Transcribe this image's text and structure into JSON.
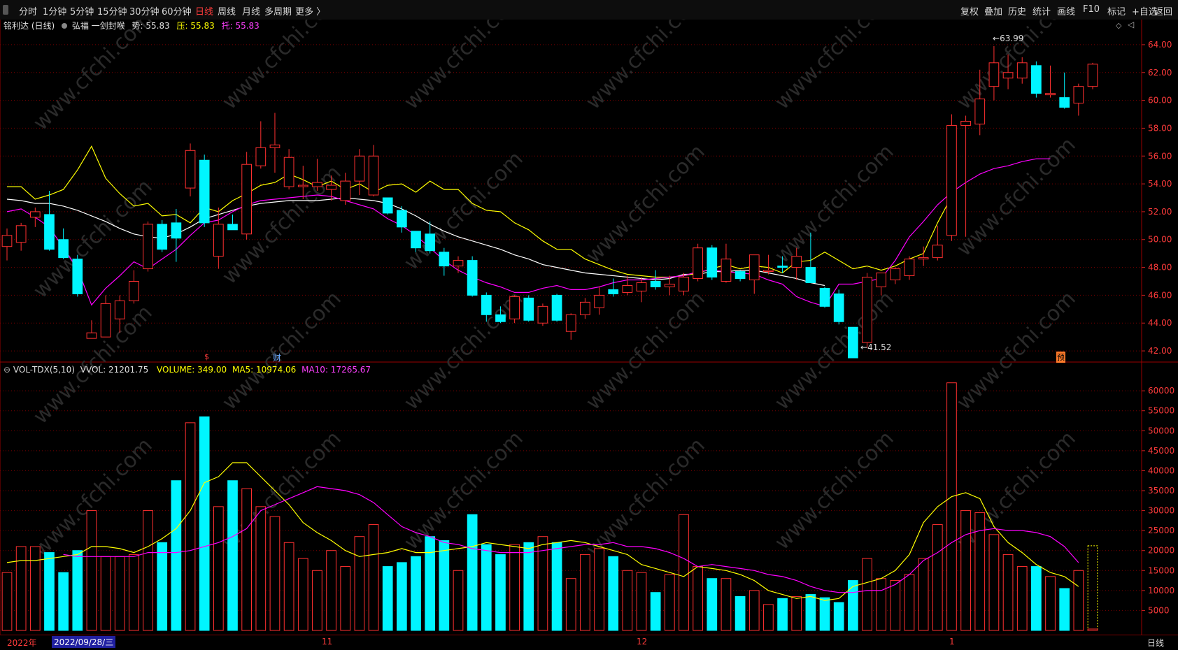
{
  "toolbar": {
    "periods": [
      "分时",
      "1分钟",
      "5分钟",
      "15分钟",
      "30分钟",
      "60分钟",
      "日线",
      "周线",
      "月线",
      "多周期",
      "更多 〉"
    ],
    "active_index": 6,
    "right_buttons": [
      "复权",
      "叠加",
      "历史",
      "统计",
      "画线",
      "F10",
      "标记",
      "+自选",
      "返回"
    ]
  },
  "header": {
    "stock": "铭利达 (日线)",
    "indicator": "弘福 一剑封喉",
    "shi_label": "势: 55.83",
    "ya_label": "压: 55.83",
    "tuo_label": "托: 55.83"
  },
  "price_axis": [
    "64.00",
    "62.00",
    "60.00",
    "58.00",
    "56.00",
    "54.00",
    "52.00",
    "50.00",
    "48.00",
    "46.00",
    "44.00",
    "42.00"
  ],
  "volume_axis": [
    "60000",
    "55000",
    "50000",
    "45000",
    "40000",
    "35000",
    "30000",
    "25000",
    "20000",
    "15000",
    "10000",
    "5000"
  ],
  "volume_header": {
    "name": "VOL-TDX(5,10)",
    "vvol": "VVOL: 21201.75",
    "volume": "VOLUME: 349.00",
    "ma5": "MA5: 10974.06",
    "ma10": "MA10: 17265.67"
  },
  "annotations": {
    "high": "63.99",
    "low": "41.52",
    "marker_s": "$",
    "marker_cai": "财",
    "marker_yu": "预"
  },
  "bottom": {
    "year": "2022年",
    "date_box": "2022/09/28/三",
    "m11": "11",
    "m12": "12",
    "m1": "1",
    "period_tag": "日线"
  },
  "colors": {
    "up": "#ff3030",
    "down": "#00f5ff",
    "ma_yellow": "#ffff00",
    "ma_white": "#ffffff",
    "ma_magenta": "#ff00ff",
    "grid": "#7a0000"
  },
  "chart_data": {
    "type": "candlestick",
    "price_range": [
      41.2,
      64.8
    ],
    "volume_range": [
      0,
      63000
    ],
    "candles": [
      {
        "o": 49.5,
        "h": 50.8,
        "l": 48.5,
        "c": 50.3,
        "v": 14500
      },
      {
        "o": 49.8,
        "h": 51.2,
        "l": 49.2,
        "c": 51.0,
        "v": 21000
      },
      {
        "o": 51.6,
        "h": 52.3,
        "l": 50.9,
        "c": 52.0,
        "v": 21000
      },
      {
        "o": 51.8,
        "h": 53.5,
        "l": 49.2,
        "c": 49.3,
        "v": 19500
      },
      {
        "o": 50.0,
        "h": 50.8,
        "l": 48.6,
        "c": 48.7,
        "v": 14500
      },
      {
        "o": 48.6,
        "h": 48.9,
        "l": 45.9,
        "c": 46.1,
        "v": 20000
      },
      {
        "o": 42.9,
        "h": 44.2,
        "l": 42.9,
        "c": 43.3,
        "v": 30000
      },
      {
        "o": 43.0,
        "h": 46.0,
        "l": 43.0,
        "c": 45.4,
        "v": 18500
      },
      {
        "o": 44.3,
        "h": 46.0,
        "l": 43.3,
        "c": 45.6,
        "v": 18500
      },
      {
        "o": 45.6,
        "h": 47.8,
        "l": 45.4,
        "c": 47.0,
        "v": 19000
      },
      {
        "o": 47.9,
        "h": 51.3,
        "l": 47.7,
        "c": 51.1,
        "v": 30000
      },
      {
        "o": 51.1,
        "h": 51.4,
        "l": 49.1,
        "c": 49.3,
        "v": 22000
      },
      {
        "o": 51.2,
        "h": 52.2,
        "l": 48.4,
        "c": 50.1,
        "v": 37500
      },
      {
        "o": 53.7,
        "h": 56.9,
        "l": 53.1,
        "c": 56.4,
        "v": 52000
      },
      {
        "o": 55.7,
        "h": 56.1,
        "l": 50.9,
        "c": 51.2,
        "v": 53500
      },
      {
        "o": 48.8,
        "h": 52.3,
        "l": 47.9,
        "c": 51.1,
        "v": 31000
      },
      {
        "o": 51.1,
        "h": 51.8,
        "l": 50.7,
        "c": 50.7,
        "v": 37500
      },
      {
        "o": 50.4,
        "h": 56.3,
        "l": 50.0,
        "c": 55.4,
        "v": 35500
      },
      {
        "o": 55.3,
        "h": 58.5,
        "l": 55.1,
        "c": 56.6,
        "v": 31000
      },
      {
        "o": 56.6,
        "h": 59.1,
        "l": 54.8,
        "c": 56.8,
        "v": 28500
      },
      {
        "o": 53.8,
        "h": 56.5,
        "l": 53.6,
        "c": 55.9,
        "v": 22000
      },
      {
        "o": 53.8,
        "h": 55.3,
        "l": 52.9,
        "c": 53.9,
        "v": 18000
      },
      {
        "o": 53.8,
        "h": 55.8,
        "l": 53.5,
        "c": 54.1,
        "v": 15000
      },
      {
        "o": 53.6,
        "h": 54.6,
        "l": 52.8,
        "c": 53.9,
        "v": 20000
      },
      {
        "o": 52.8,
        "h": 54.8,
        "l": 52.5,
        "c": 54.2,
        "v": 16000
      },
      {
        "o": 54.2,
        "h": 56.5,
        "l": 53.2,
        "c": 56.0,
        "v": 23500
      },
      {
        "o": 53.2,
        "h": 56.8,
        "l": 53.1,
        "c": 56.0,
        "v": 26500
      },
      {
        "o": 53.0,
        "h": 53.0,
        "l": 51.8,
        "c": 51.9,
        "v": 16000
      },
      {
        "o": 52.1,
        "h": 52.4,
        "l": 50.5,
        "c": 50.9,
        "v": 17000
      },
      {
        "o": 50.6,
        "h": 50.6,
        "l": 49.1,
        "c": 49.4,
        "v": 18500
      },
      {
        "o": 50.4,
        "h": 51.3,
        "l": 49.0,
        "c": 49.2,
        "v": 23500
      },
      {
        "o": 49.1,
        "h": 49.4,
        "l": 47.4,
        "c": 48.1,
        "v": 22500
      },
      {
        "o": 48.1,
        "h": 48.8,
        "l": 47.6,
        "c": 48.5,
        "v": 15000
      },
      {
        "o": 48.5,
        "h": 48.8,
        "l": 45.9,
        "c": 46.0,
        "v": 29000
      },
      {
        "o": 46.0,
        "h": 46.2,
        "l": 44.1,
        "c": 44.6,
        "v": 21500
      },
      {
        "o": 44.6,
        "h": 45.2,
        "l": 44.0,
        "c": 44.1,
        "v": 19000
      },
      {
        "o": 44.3,
        "h": 46.0,
        "l": 44.0,
        "c": 45.9,
        "v": 21500
      },
      {
        "o": 45.8,
        "h": 46.0,
        "l": 44.1,
        "c": 44.2,
        "v": 22000
      },
      {
        "o": 44.0,
        "h": 45.4,
        "l": 43.8,
        "c": 45.2,
        "v": 23500
      },
      {
        "o": 46.0,
        "h": 46.1,
        "l": 44.1,
        "c": 44.2,
        "v": 22000
      },
      {
        "o": 43.4,
        "h": 44.7,
        "l": 42.8,
        "c": 44.6,
        "v": 13000
      },
      {
        "o": 44.6,
        "h": 45.8,
        "l": 44.3,
        "c": 45.5,
        "v": 19000
      },
      {
        "o": 45.1,
        "h": 46.6,
        "l": 44.6,
        "c": 46.0,
        "v": 20500
      },
      {
        "o": 46.4,
        "h": 47.2,
        "l": 45.9,
        "c": 46.1,
        "v": 18500
      },
      {
        "o": 46.2,
        "h": 47.4,
        "l": 46.0,
        "c": 46.7,
        "v": 15000
      },
      {
        "o": 46.3,
        "h": 47.3,
        "l": 45.5,
        "c": 46.9,
        "v": 14500
      },
      {
        "o": 47.0,
        "h": 47.8,
        "l": 46.4,
        "c": 46.6,
        "v": 9500
      },
      {
        "o": 46.6,
        "h": 47.4,
        "l": 46.0,
        "c": 46.8,
        "v": 14000
      },
      {
        "o": 46.3,
        "h": 47.6,
        "l": 46.0,
        "c": 47.3,
        "v": 29000
      },
      {
        "o": 47.2,
        "h": 49.7,
        "l": 47.0,
        "c": 49.4,
        "v": 16000
      },
      {
        "o": 49.4,
        "h": 49.6,
        "l": 47.1,
        "c": 47.3,
        "v": 13000
      },
      {
        "o": 47.0,
        "h": 49.7,
        "l": 46.9,
        "c": 48.6,
        "v": 13000
      },
      {
        "o": 47.7,
        "h": 47.8,
        "l": 47.0,
        "c": 47.2,
        "v": 8500
      },
      {
        "o": 47.1,
        "h": 48.9,
        "l": 46.1,
        "c": 48.9,
        "v": 10000
      },
      {
        "o": 47.7,
        "h": 48.9,
        "l": 47.5,
        "c": 47.8,
        "v": 6500
      },
      {
        "o": 48.1,
        "h": 48.8,
        "l": 47.6,
        "c": 48.0,
        "v": 8000
      },
      {
        "o": 48.0,
        "h": 49.4,
        "l": 47.1,
        "c": 48.8,
        "v": 8500
      },
      {
        "o": 48.0,
        "h": 50.5,
        "l": 46.9,
        "c": 46.9,
        "v": 9000
      },
      {
        "o": 46.5,
        "h": 46.6,
        "l": 45.1,
        "c": 45.2,
        "v": 8200
      },
      {
        "o": 46.1,
        "h": 46.4,
        "l": 43.9,
        "c": 44.1,
        "v": 7000
      },
      {
        "o": 43.7,
        "h": 43.7,
        "l": 41.5,
        "c": 41.5,
        "v": 12500
      },
      {
        "o": 42.6,
        "h": 47.6,
        "l": 42.2,
        "c": 47.3,
        "v": 18000
      },
      {
        "o": 46.6,
        "h": 47.6,
        "l": 46.0,
        "c": 47.6,
        "v": 13000
      },
      {
        "o": 47.1,
        "h": 48.0,
        "l": 46.8,
        "c": 47.9,
        "v": 12500
      },
      {
        "o": 47.4,
        "h": 48.8,
        "l": 47.1,
        "c": 48.6,
        "v": 14000
      },
      {
        "o": 48.6,
        "h": 49.5,
        "l": 48.1,
        "c": 48.7,
        "v": 18000
      },
      {
        "o": 48.7,
        "h": 51.0,
        "l": 48.5,
        "c": 49.6,
        "v": 26500
      },
      {
        "o": 50.3,
        "h": 59.0,
        "l": 49.9,
        "c": 58.2,
        "v": 62000
      },
      {
        "o": 58.2,
        "h": 58.9,
        "l": 50.2,
        "c": 58.5,
        "v": 30000
      },
      {
        "o": 58.3,
        "h": 62.2,
        "l": 57.5,
        "c": 60.1,
        "v": 29500
      },
      {
        "o": 61.0,
        "h": 63.9,
        "l": 60.0,
        "c": 62.7,
        "v": 24000
      },
      {
        "o": 61.6,
        "h": 63.3,
        "l": 60.8,
        "c": 62.0,
        "v": 19000
      },
      {
        "o": 61.6,
        "h": 63.1,
        "l": 61.2,
        "c": 62.7,
        "v": 16000
      },
      {
        "o": 62.5,
        "h": 62.8,
        "l": 60.2,
        "c": 60.5,
        "v": 16000
      },
      {
        "o": 60.4,
        "h": 62.5,
        "l": 60.2,
        "c": 60.5,
        "v": 13500
      },
      {
        "o": 60.2,
        "h": 62.0,
        "l": 59.4,
        "c": 59.5,
        "v": 10500
      },
      {
        "o": 59.8,
        "h": 61.2,
        "l": 58.9,
        "c": 61.0,
        "v": 15000
      },
      {
        "o": 61.0,
        "h": 62.7,
        "l": 60.8,
        "c": 62.6,
        "v": 350
      }
    ],
    "ma_yellow": [
      53.8,
      53.8,
      52.9,
      53.2,
      53.6,
      55.0,
      56.7,
      54.4,
      53.3,
      52.4,
      52.6,
      51.7,
      51.8,
      51.2,
      52.3,
      52.0,
      52.8,
      53.3,
      53.9,
      54.1,
      54.7,
      54.3,
      53.8,
      54.2,
      53.6,
      54.0,
      53.4,
      53.9,
      54.0,
      53.4,
      54.2,
      53.6,
      53.6,
      52.6,
      52.1,
      52.0,
      51.2,
      50.7,
      49.9,
      49.3,
      49.3,
      48.6,
      48.2,
      47.8,
      47.5,
      47.4,
      47.3,
      47.3,
      47.4,
      47.6,
      47.9,
      48.2,
      47.9,
      48.1,
      48.0,
      47.6,
      48.4,
      48.5,
      49.1,
      48.5,
      47.9,
      48.1,
      47.8,
      48.1,
      48.6,
      49.0,
      51.2,
      53.1
    ],
    "ma_white": [
      52.9,
      52.8,
      52.6,
      52.6,
      52.4,
      52.1,
      51.7,
      51.3,
      50.8,
      50.4,
      50.2,
      50.1,
      50.4,
      50.9,
      51.5,
      51.8,
      52.1,
      52.4,
      52.6,
      52.7,
      52.8,
      52.8,
      52.8,
      52.9,
      53.0,
      52.9,
      52.8,
      52.6,
      52.2,
      51.7,
      51.1,
      50.6,
      50.2,
      49.9,
      49.6,
      49.3,
      48.9,
      48.6,
      48.2,
      48.0,
      47.8,
      47.6,
      47.5,
      47.4,
      47.3,
      47.2,
      47.1,
      47.2,
      47.5,
      47.5,
      47.7,
      47.7,
      47.8,
      47.8,
      47.6,
      47.4,
      47.2,
      46.9,
      46.7
    ],
    "ma_magenta": [
      52.0,
      52.2,
      51.6,
      50.9,
      49.4,
      47.9,
      45.3,
      46.5,
      47.4,
      48.4,
      47.9,
      48.6,
      49.3,
      50.3,
      51.2,
      51.4,
      52.0,
      52.5,
      52.8,
      52.9,
      53.0,
      53.1,
      53.2,
      53.1,
      52.8,
      52.5,
      52.2,
      51.5,
      51.0,
      50.3,
      49.4,
      48.5,
      47.8,
      47.3,
      46.9,
      46.6,
      46.2,
      46.2,
      46.5,
      46.7,
      46.4,
      46.4,
      46.6,
      46.9,
      47.1,
      47.1,
      47.2,
      47.3,
      47.4,
      47.7,
      47.8,
      47.7,
      47.6,
      47.5,
      47.1,
      46.8,
      45.9,
      45.5,
      45.2,
      46.8,
      46.8,
      47.0,
      47.2,
      48.5,
      50.2,
      51.3,
      52.5,
      53.4,
      54.1,
      54.7,
      55.1,
      55.3,
      55.6,
      55.8,
      55.8
    ],
    "vol_ma5": [
      17000,
      17500,
      17500,
      18000,
      18500,
      19000,
      21000,
      21000,
      20500,
      19500,
      21000,
      23000,
      25500,
      30000,
      37000,
      38500,
      42000,
      42000,
      38500,
      35000,
      31500,
      27000,
      24500,
      22500,
      20000,
      18500,
      19000,
      19500,
      20500,
      19500,
      19500,
      20000,
      20500,
      21000,
      22000,
      21500,
      21000,
      20500,
      21500,
      22000,
      22500,
      22000,
      21000,
      20000,
      19000,
      16500,
      15500,
      14500,
      13500,
      16000,
      15500,
      15000,
      14000,
      12500,
      10000,
      9000,
      8000,
      8500,
      7500,
      8000,
      11000,
      12000,
      13000,
      15000,
      19000,
      27000,
      31000,
      33500,
      34500,
      33000,
      26000,
      22000,
      19500,
      16500,
      14500,
      13500,
      11000
    ],
    "vol_ma10": [
      19000,
      18500,
      18500,
      18500,
      18500,
      18500,
      19500,
      19500,
      19500,
      20000,
      21000,
      22000,
      23500,
      25500,
      30000,
      31500,
      33000,
      34500,
      36000,
      35500,
      35000,
      34000,
      32000,
      29000,
      26000,
      24500,
      23500,
      22000,
      21500,
      20500,
      20000,
      19500,
      19500,
      19500,
      20000,
      20500,
      21000,
      21500,
      21500,
      22000,
      21000,
      21000,
      20500,
      19500,
      18000,
      16000,
      16500,
      16000,
      15500,
      15000,
      14000,
      13500,
      12500,
      11000,
      10000,
      9500,
      9500,
      10000,
      10000,
      11500,
      14000,
      17500,
      19500,
      22000,
      24000,
      25000,
      25500,
      25000,
      25000,
      24500,
      23500,
      21000,
      17000
    ]
  }
}
